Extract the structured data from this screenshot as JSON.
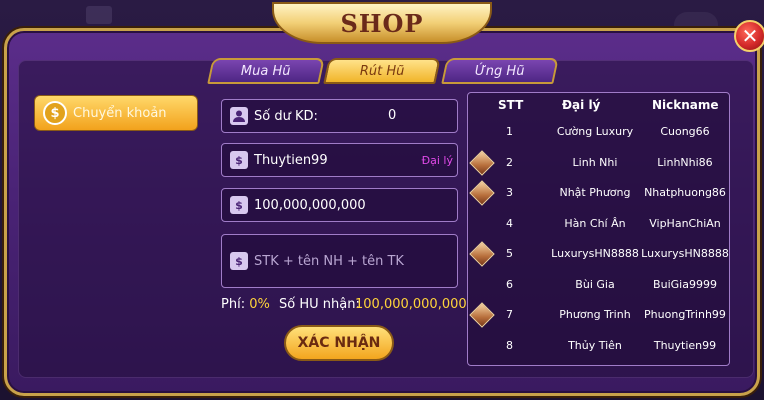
{
  "title": "SHOP",
  "close_label": "✕",
  "tabs": [
    {
      "label": "Mua Hũ",
      "active": false
    },
    {
      "label": "Rút Hũ",
      "active": true
    },
    {
      "label": "Ứng Hũ",
      "active": false
    }
  ],
  "sidebar": {
    "button_label": "Chuyển khoản",
    "icon_glyph": "$"
  },
  "form": {
    "balance_label": "Số dư KD:",
    "balance_value": "0",
    "username": "Thuytien99",
    "agent_tag": "Đại lý",
    "amount": "100,000,000,000",
    "note_placeholder": "STK + tên NH + tên TK",
    "fee_label": "Phí:",
    "fee_value": "0%",
    "received_label": "Số HU nhận:",
    "received_value": "100,000,000,000",
    "confirm_label": "XÁC NHẬN"
  },
  "table": {
    "headers": [
      "STT",
      "Đại lý",
      "Nickname"
    ],
    "rows": [
      {
        "stt": "1",
        "agent": "Cường Luxury",
        "nickname": "Cuong66",
        "diamond": false
      },
      {
        "stt": "2",
        "agent": "Linh Nhi",
        "nickname": "LinhNhi86",
        "diamond": true
      },
      {
        "stt": "3",
        "agent": "Nhật Phương",
        "nickname": "Nhatphuong86",
        "diamond": true
      },
      {
        "stt": "4",
        "agent": "Hàn Chí Ân",
        "nickname": "VipHanChiAn",
        "diamond": false
      },
      {
        "stt": "5",
        "agent": "LuxurysHN8888",
        "nickname": "LuxurysHN8888",
        "diamond": true
      },
      {
        "stt": "6",
        "agent": "Bùi Gia",
        "nickname": "BuiGia9999",
        "diamond": false
      },
      {
        "stt": "7",
        "agent": "Phương Trinh",
        "nickname": "PhuongTrinh99",
        "diamond": true
      },
      {
        "stt": "8",
        "agent": "Thủy Tiên",
        "nickname": "Thuytien99",
        "diamond": false
      }
    ]
  },
  "colors": {
    "accent_gold": "#f2a21c",
    "panel_purple": "#4a2376",
    "highlight_yellow": "#ffd43a",
    "agent_magenta": "#e04ae8"
  },
  "icons": {
    "close": "close-icon",
    "coin": "coin-icon",
    "user": "user-icon",
    "moneybag": "moneybag-icon",
    "diamond": "diamond-icon"
  }
}
